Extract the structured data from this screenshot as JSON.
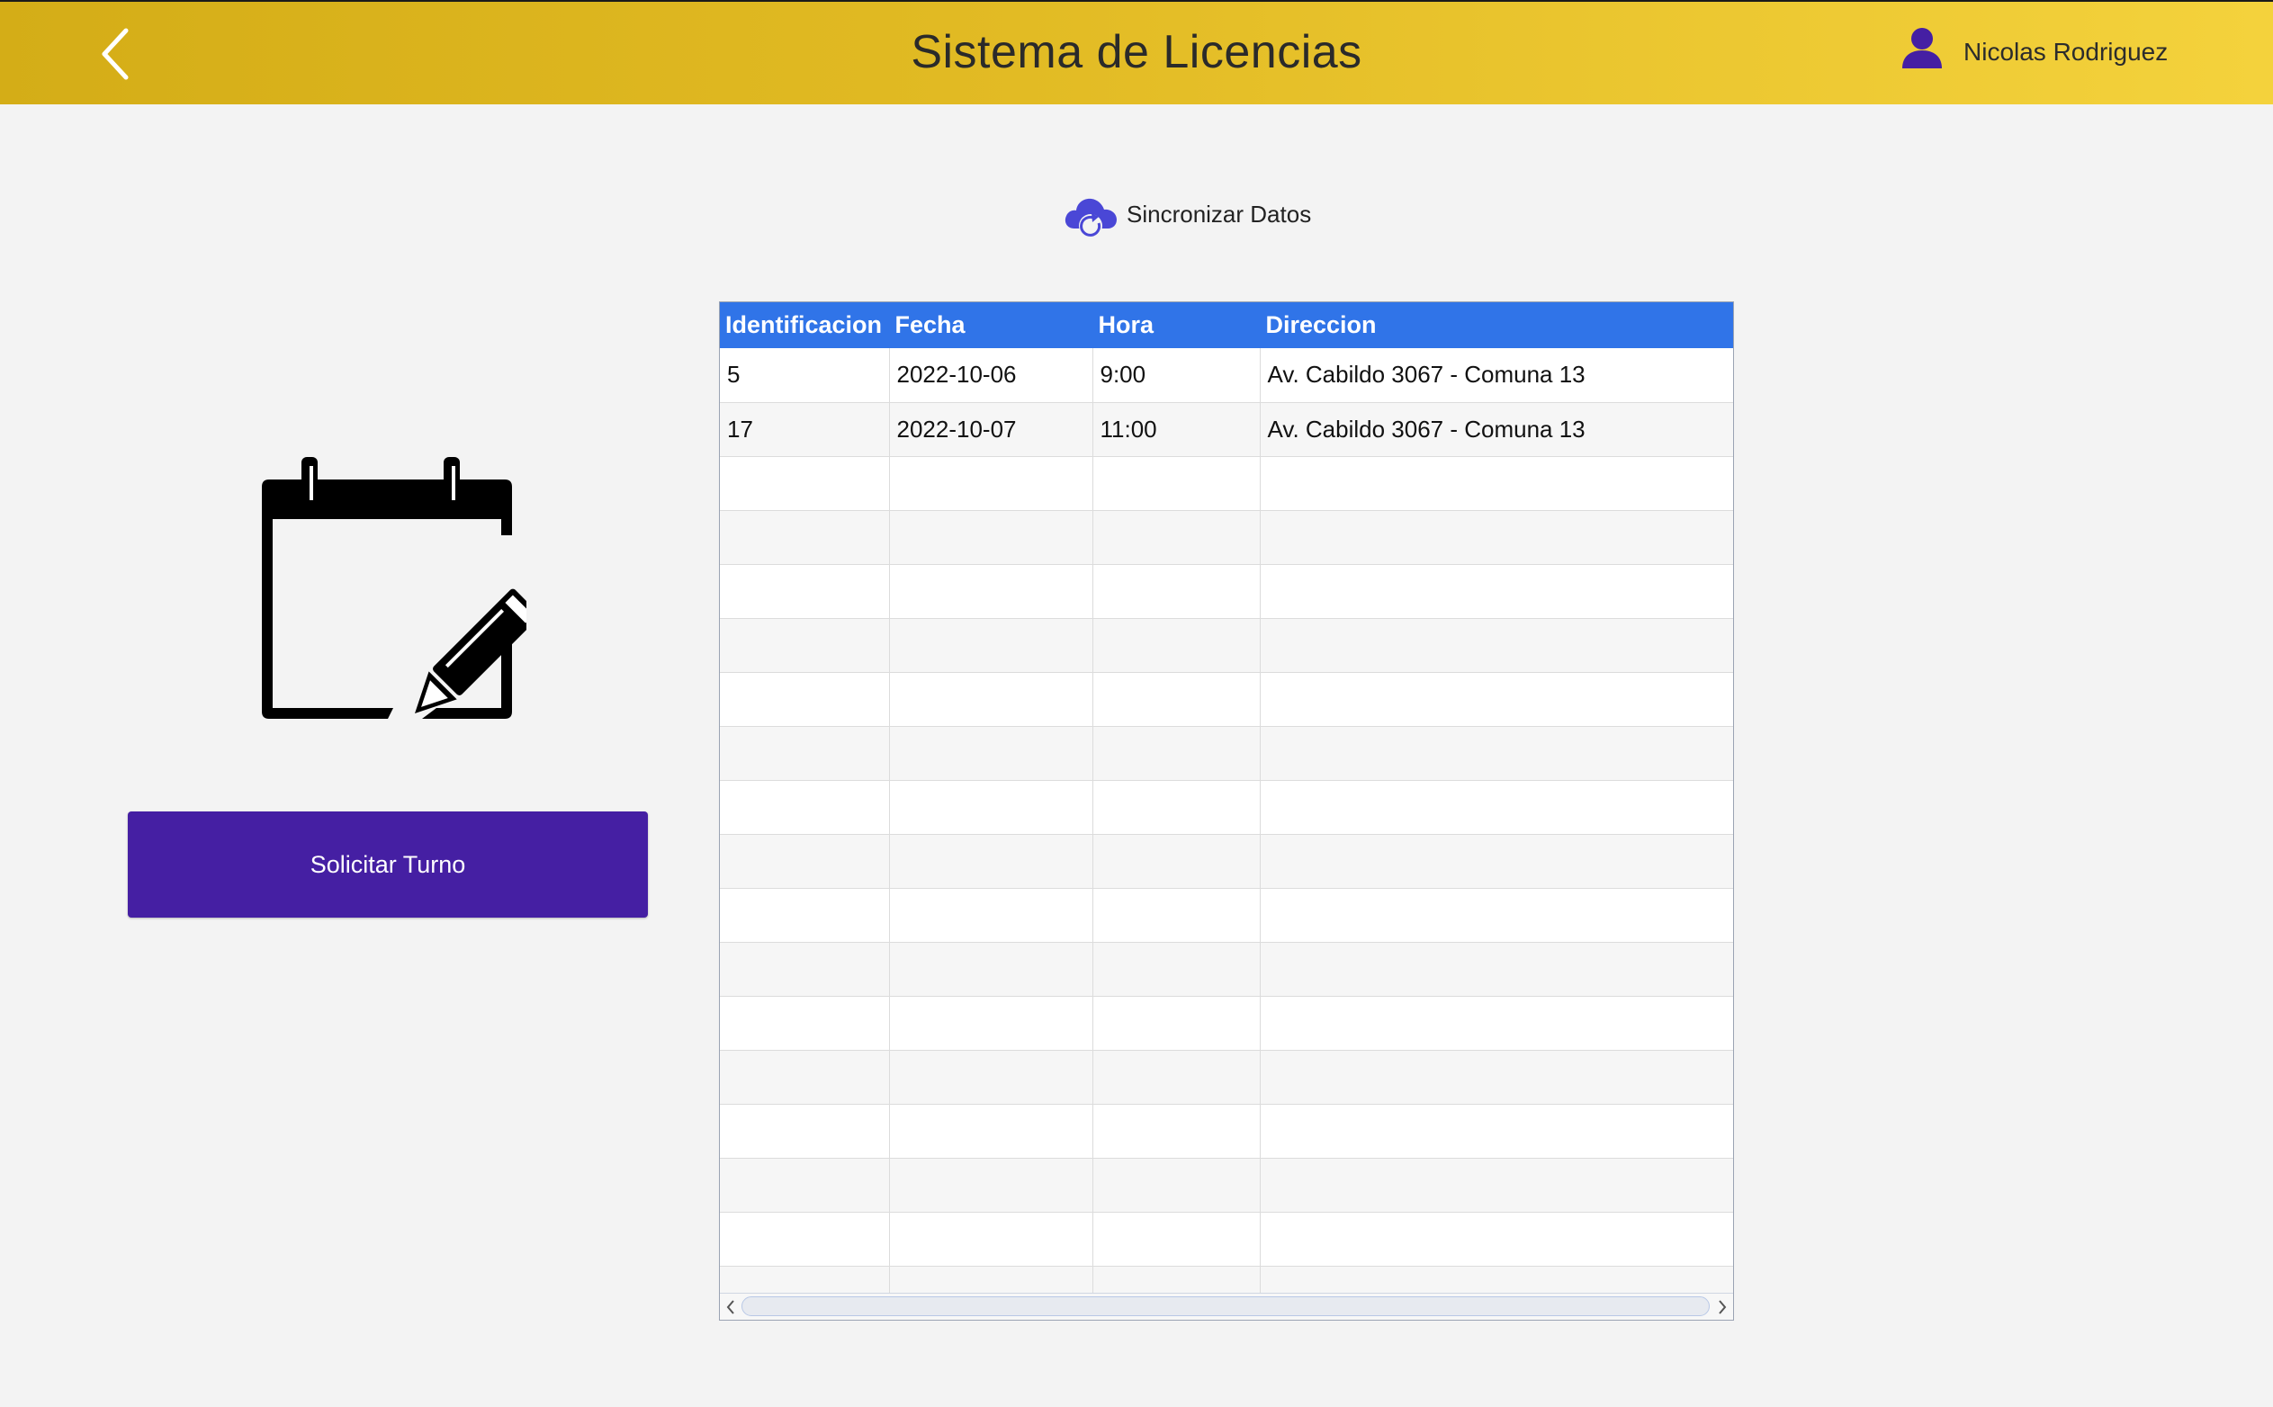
{
  "header": {
    "title": "Sistema de Licencias",
    "user_name": "Nicolas Rodriguez",
    "back_icon": "chevron-left-icon",
    "user_icon": "user-icon",
    "gradient_colors": [
      "#d4ad17",
      "#f4d23c"
    ]
  },
  "sync": {
    "label": "Sincronizar Datos",
    "icon": "cloud-sync-icon",
    "icon_color": "#4a47d6"
  },
  "calendar": {
    "icon": "calendar-edit-icon"
  },
  "solicitar": {
    "label": "Solicitar Turno",
    "color": "#451fa3"
  },
  "grid": {
    "header_color": "#3074e8",
    "columns": [
      "Identificacion",
      "Fecha",
      "Hora",
      "Direccion"
    ],
    "rows": [
      [
        "5",
        "2022-10-06",
        "9:00",
        "Av. Cabildo 3067 - Comuna 13"
      ],
      [
        "17",
        "2022-10-07",
        "11:00",
        "Av. Cabildo 3067 - Comuna 13"
      ]
    ],
    "empty_row_count": 16
  }
}
